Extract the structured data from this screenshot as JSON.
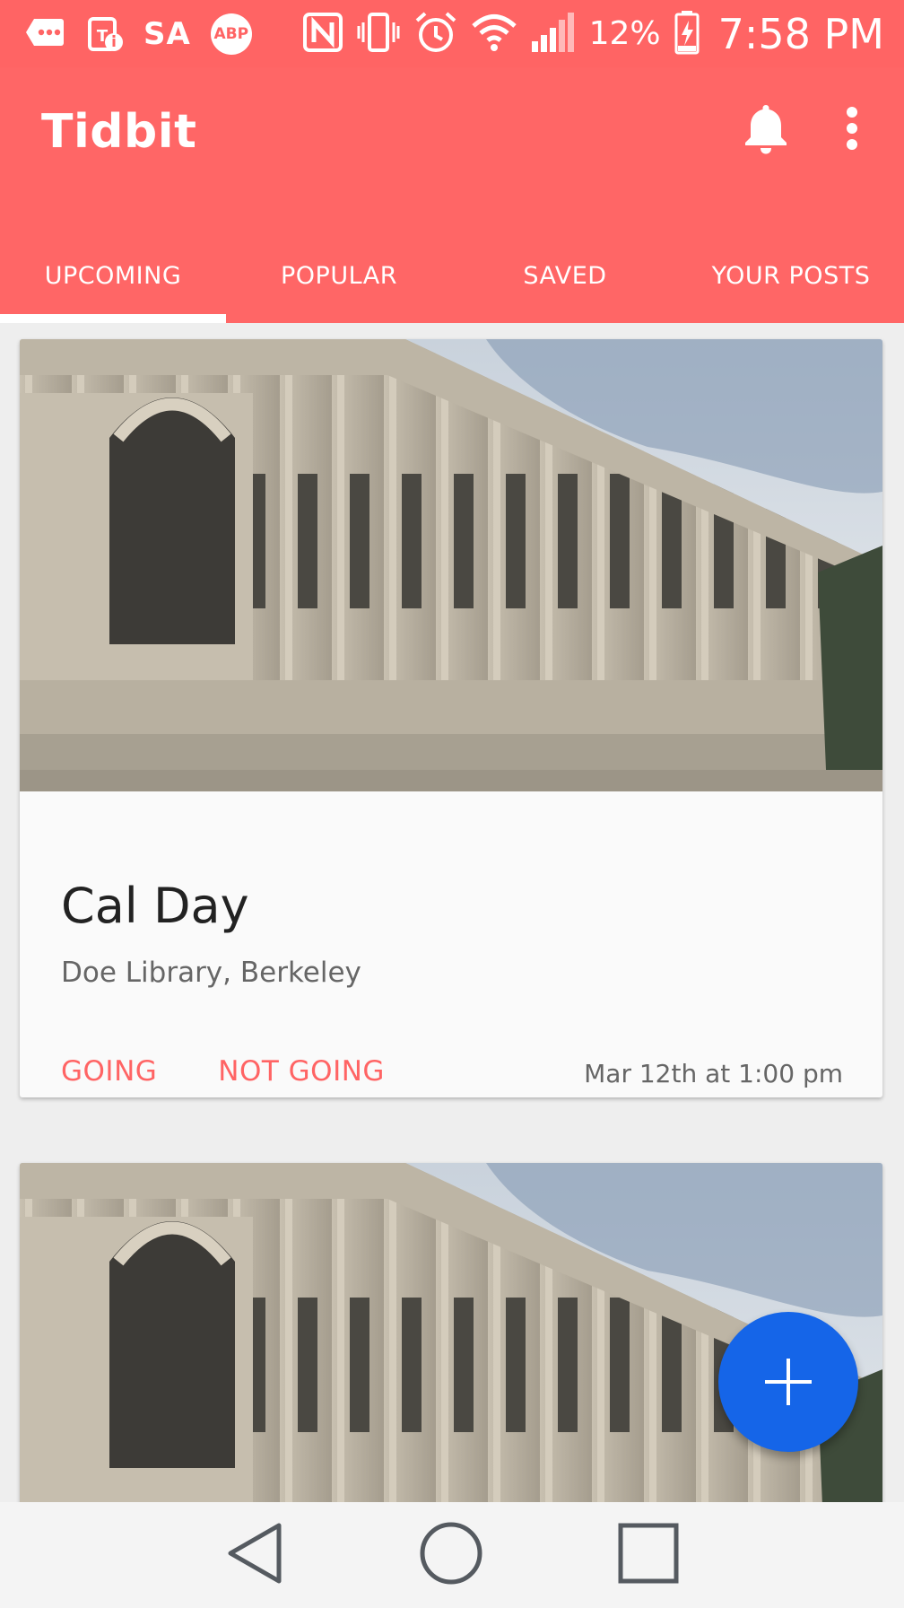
{
  "status_bar": {
    "carrier_badge": "SA",
    "adblock_badge": "ABP",
    "battery_percent": "12%",
    "time": "7:58 PM",
    "icons": [
      "message-dots-icon",
      "tmobile-info-icon",
      "nfc-icon",
      "vibrate-icon",
      "alarm-icon",
      "wifi-icon",
      "signal-icon",
      "battery-charging-icon"
    ]
  },
  "app_bar": {
    "title": "Tidbit",
    "actions": [
      "bell-icon",
      "overflow-menu-icon"
    ]
  },
  "tabs": [
    {
      "label": "UPCOMING",
      "active": true
    },
    {
      "label": "POPULAR",
      "active": false
    },
    {
      "label": "SAVED",
      "active": false
    },
    {
      "label": "YOUR POSTS",
      "active": false
    }
  ],
  "events": [
    {
      "title": "Cal Day",
      "location": "Doe Library, Berkeley",
      "going_label": "GOING",
      "not_going_label": "NOT GOING",
      "datetime": "Mar 12th at 1:00 pm"
    }
  ],
  "fab": {
    "icon": "plus-icon"
  },
  "nav_bar": {
    "icons": [
      "back-icon",
      "home-icon",
      "recents-icon"
    ]
  },
  "colors": {
    "primary": "#ff6666",
    "accent_text": "#ff6464",
    "fab": "#1565e8",
    "background": "#eeeeee"
  }
}
